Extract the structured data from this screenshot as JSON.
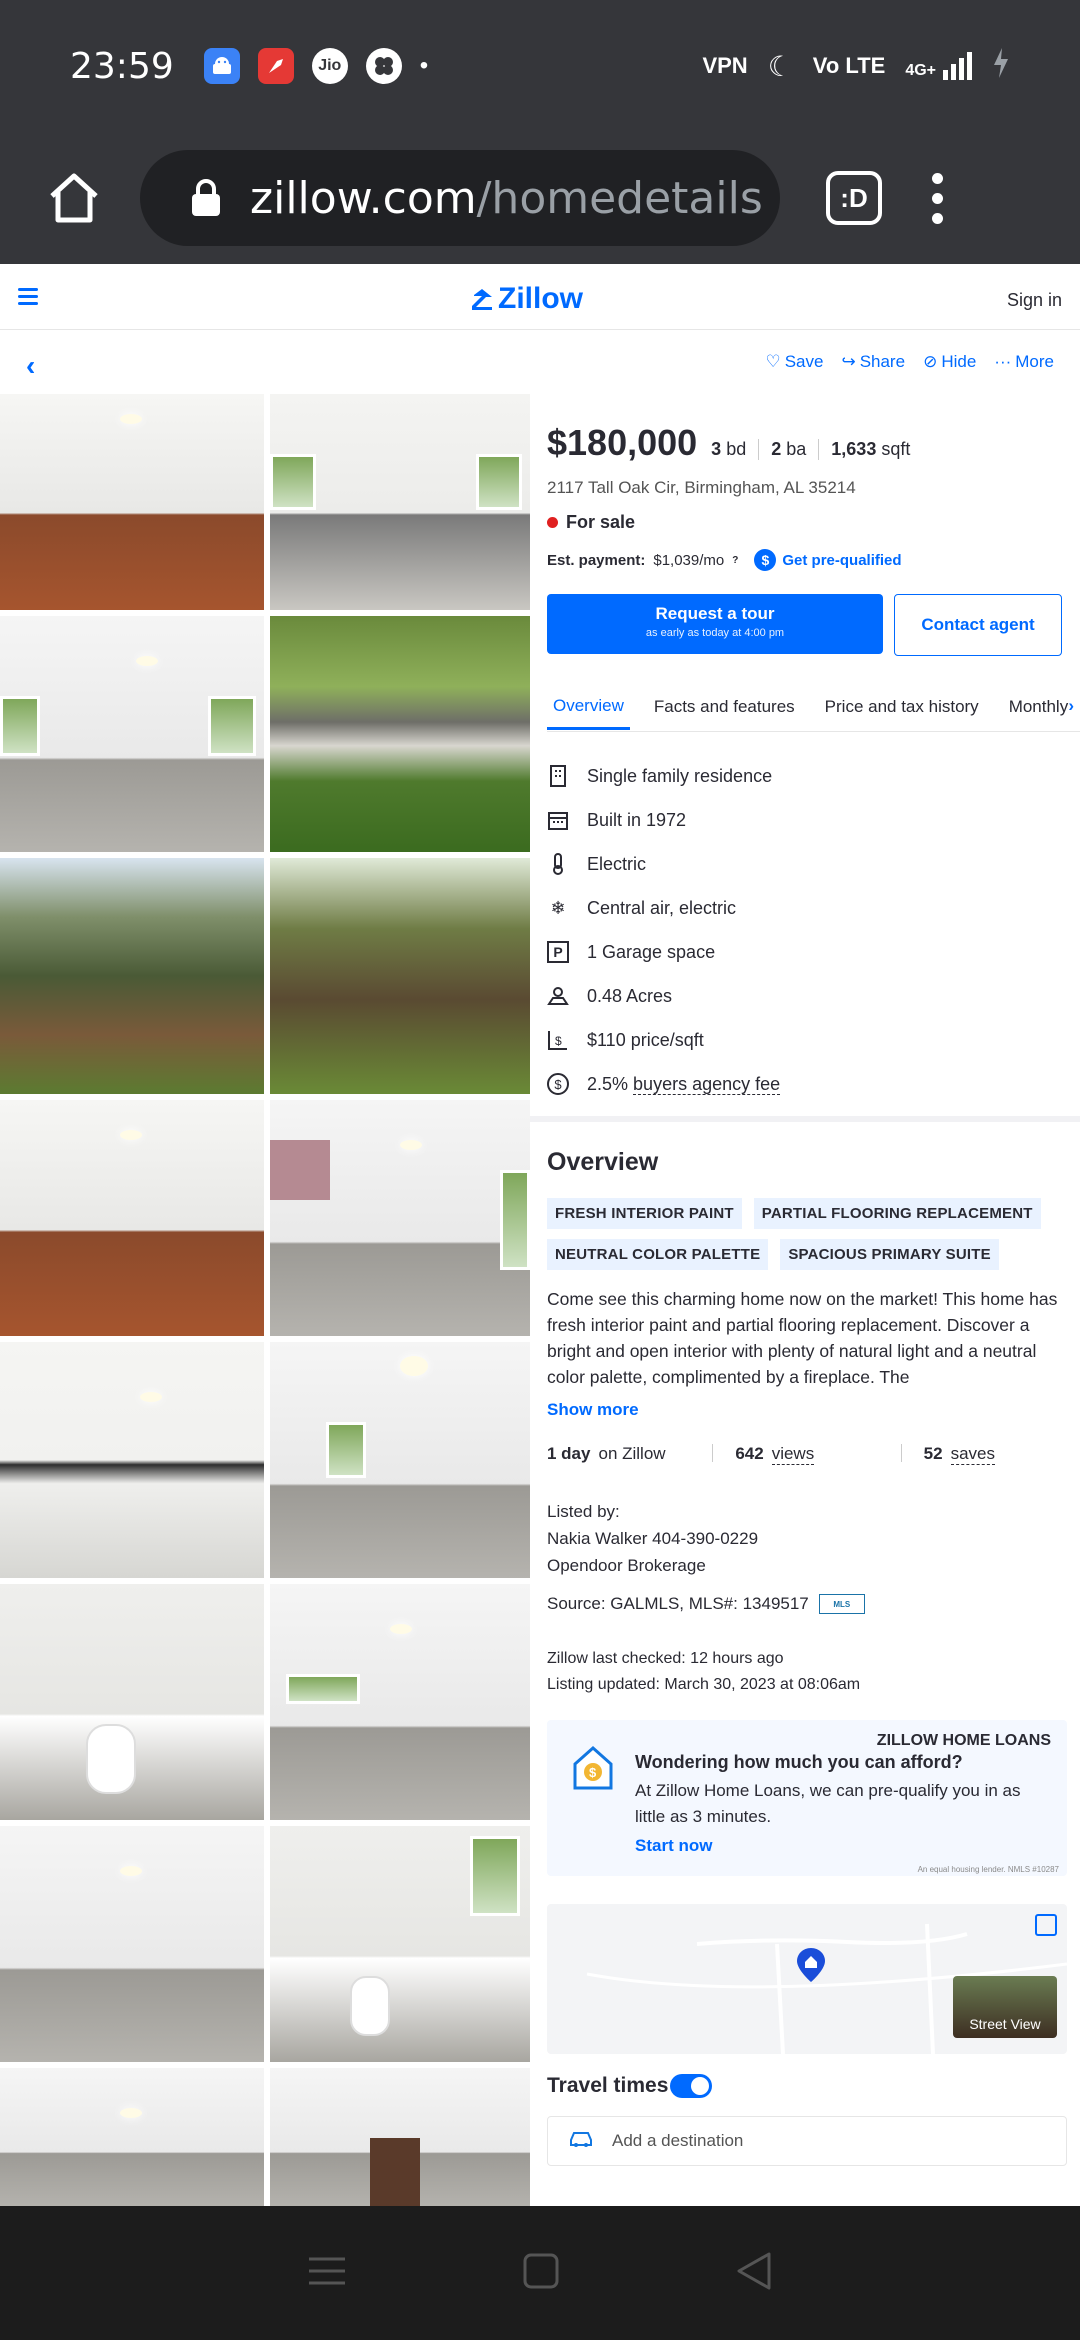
{
  "status_bar": {
    "time": "23:59",
    "app_icons": [
      "android-icon",
      "rocket-icon",
      "jio-icon",
      "fan-icon"
    ],
    "jio_label": "Jio",
    "dot": "•",
    "right_labels": {
      "vpn": "VPN",
      "volte": "Vo LTE",
      "net": "4G+"
    }
  },
  "browser": {
    "url_main": "zillow.com",
    "url_path": "/homedetails",
    "tab_label": ":D"
  },
  "header": {
    "logo": "Zillow",
    "sign_in": "Sign in"
  },
  "actions": {
    "save": "Save",
    "share": "Share",
    "hide": "Hide",
    "more": "More"
  },
  "listing": {
    "price": "$180,000",
    "beds": "3",
    "beds_unit": "bd",
    "baths": "2",
    "baths_unit": "ba",
    "sqft": "1,633",
    "sqft_unit": "sqft",
    "address": "2117 Tall Oak Cir, Birmingham, AL 35214",
    "status": "For sale",
    "est_payment_label": "Est. payment:",
    "est_payment": "$1,039/mo",
    "prequal": "Get pre-qualified",
    "tour_label": "Request a tour",
    "tour_sub": "as early as today at 4:00 pm",
    "contact": "Contact agent"
  },
  "tabs": [
    "Overview",
    "Facts and features",
    "Price and tax history",
    "Monthly"
  ],
  "facts": [
    {
      "icon": "building-icon",
      "text": "Single family residence"
    },
    {
      "icon": "calendar-icon",
      "text": "Built in 1972"
    },
    {
      "icon": "thermometer-icon",
      "text": "Electric"
    },
    {
      "icon": "snowflake-icon",
      "text": "Central air, electric"
    },
    {
      "icon": "parking-icon",
      "text": "1 Garage space"
    },
    {
      "icon": "lot-icon",
      "text": "0.48 Acres"
    },
    {
      "icon": "price-sqft-icon",
      "text": "$110 price/sqft"
    },
    {
      "icon": "fee-icon",
      "text": "2.5%",
      "link": "buyers agency fee"
    }
  ],
  "overview": {
    "title": "Overview",
    "chips": [
      "FRESH INTERIOR PAINT",
      "PARTIAL FLOORING REPLACEMENT",
      "NEUTRAL COLOR PALETTE",
      "SPACIOUS PRIMARY SUITE"
    ],
    "description": "Come see this charming home now on the market! This home has fresh interior paint and partial flooring replacement. Discover a bright and open interior with plenty of natural light and a neutral color palette, complimented by a fireplace. The",
    "show_more": "Show more",
    "stats": [
      {
        "value": "1 day",
        "label": "on Zillow"
      },
      {
        "value": "642",
        "label": "views"
      },
      {
        "value": "52",
        "label": "saves"
      }
    ],
    "listed_by": "Listed by:",
    "agent": "Nakia Walker 404-390-0229",
    "brokerage": "Opendoor Brokerage",
    "source": "Source: GALMLS,  MLS#: 1349517",
    "last_checked": "Zillow last checked: 12 hours ago",
    "listing_updated": "Listing updated: March 30, 2023 at 08:06am"
  },
  "loans": {
    "header": "ZILLOW HOME LOANS",
    "question": "Wondering how much you can afford?",
    "body": "At Zillow Home Loans, we can pre-qualify you in as little as 3 minutes.",
    "start": "Start now",
    "fine": "An equal housing lender. NMLS #10287"
  },
  "map": {
    "street_view": "Street View"
  },
  "travel": {
    "title": "Travel times",
    "add_destination": "Add a destination"
  },
  "colors": {
    "zillow_blue": "#006aff",
    "status_red": "#e02020",
    "chip_bg": "#e9f2ff"
  }
}
